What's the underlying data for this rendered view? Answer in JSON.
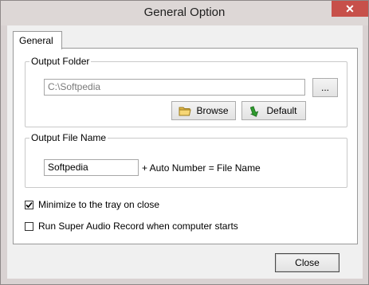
{
  "window": {
    "title": "General Option",
    "close_glyph": "✕"
  },
  "tabs": [
    {
      "label": "General"
    }
  ],
  "output_folder": {
    "label": "Output Folder",
    "path_value": "C:\\Softpedia",
    "browse_dots_label": "...",
    "browse_label": "Browse",
    "default_label": "Default",
    "browse_icon": "folder-icon",
    "default_icon": "green-arrow-icon"
  },
  "output_file_name": {
    "label": "Output File Name",
    "value": "Softpedia",
    "suffix_text": "+ Auto Number = File Name"
  },
  "options": {
    "minimize_label": "Minimize to the tray on close",
    "minimize_checked": true,
    "autostart_label": "Run Super Audio Record when computer starts",
    "autostart_checked": false
  },
  "footer": {
    "close_label": "Close"
  }
}
